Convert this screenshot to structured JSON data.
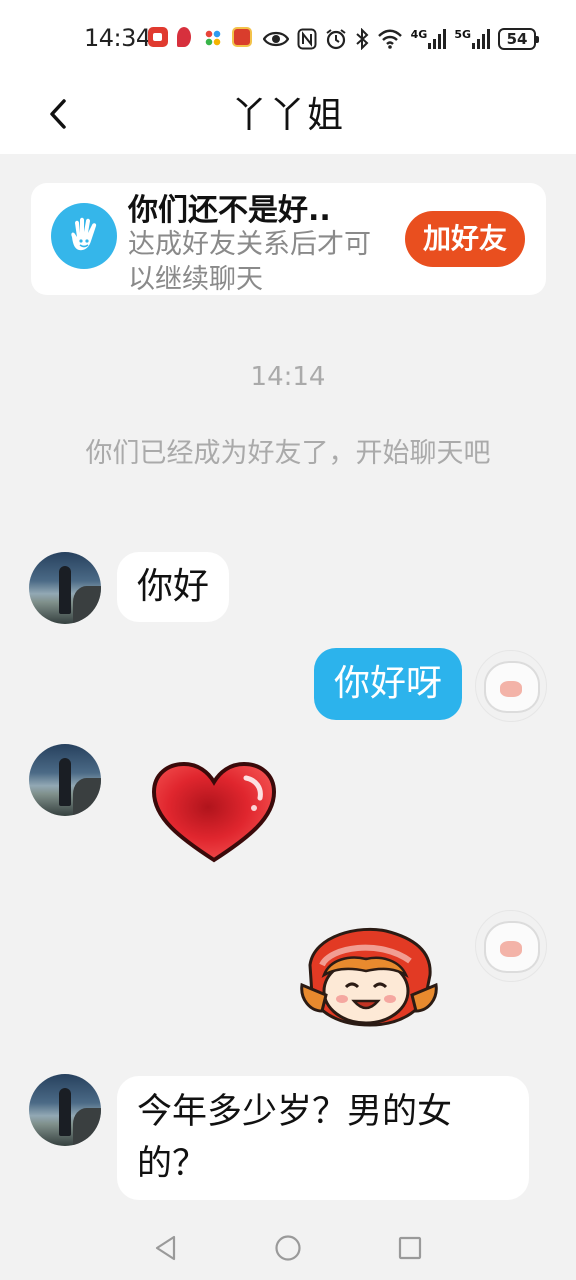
{
  "status_bar": {
    "time": "14:34",
    "network_1": "4G",
    "network_2": "5G",
    "battery": "54"
  },
  "header": {
    "title": "丫丫姐"
  },
  "friend_banner": {
    "title": "你们还不是好..",
    "subtitle": "达成好友关系后才可以继续聊天",
    "add_button": "加好友"
  },
  "chat": {
    "timestamp": "14:14",
    "system_message": "你们已经成为好友了，开始聊天吧",
    "messages": [
      {
        "side": "incoming",
        "type": "text",
        "text": "你好"
      },
      {
        "side": "outgoing",
        "type": "text",
        "text": "你好呀"
      },
      {
        "side": "incoming",
        "type": "sticker",
        "sticker": "heart-sticker"
      },
      {
        "side": "outgoing",
        "type": "sticker",
        "sticker": "girl-sticker"
      },
      {
        "side": "incoming",
        "type": "text",
        "text": "今年多少岁？男的女的？"
      }
    ]
  },
  "colors": {
    "accent_blue": "#2cb3ec",
    "add_friend_orange": "#e94f1f",
    "background": "#f2f2f2"
  }
}
